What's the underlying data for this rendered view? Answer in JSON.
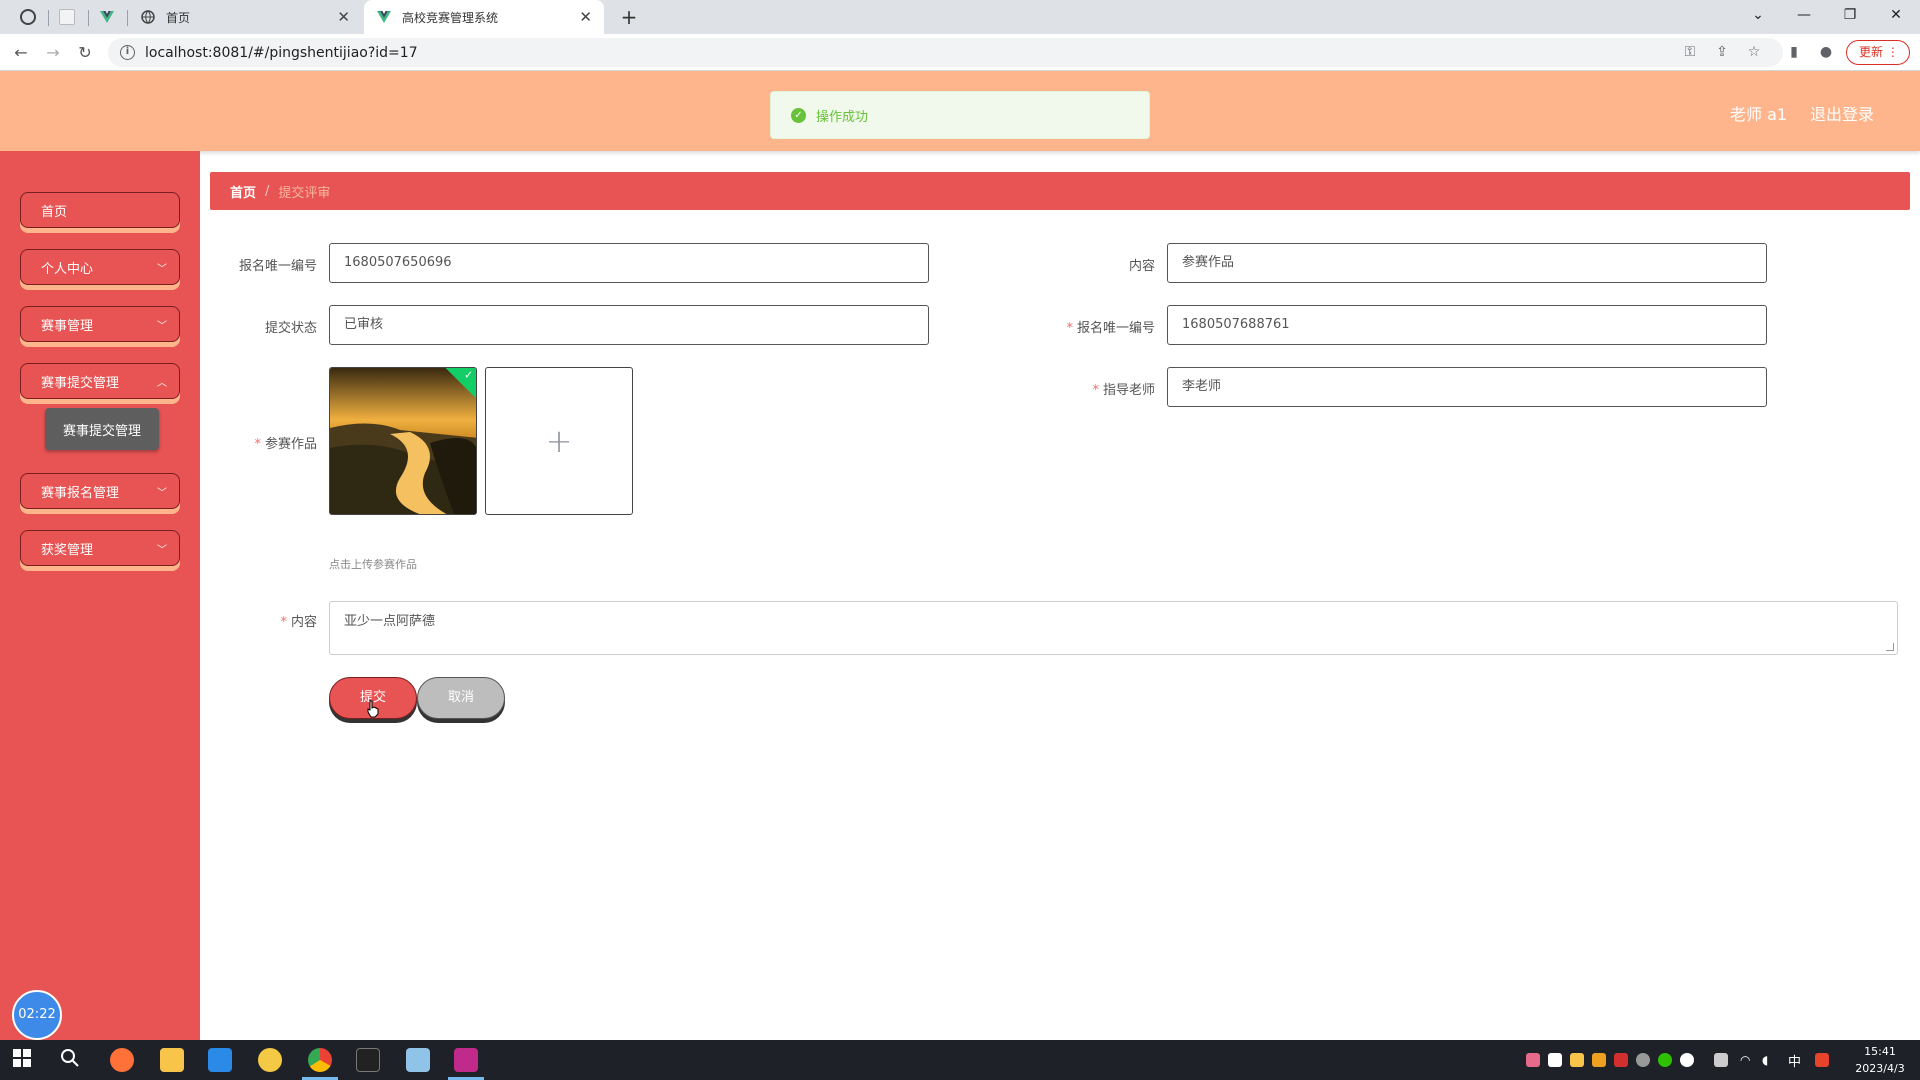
{
  "browser": {
    "tabs": [
      {
        "title": "首页"
      },
      {
        "title": "高校竞赛管理系统"
      }
    ],
    "url": "localhost:8081/#/pingshentijiao?id=17",
    "update_label": "更新"
  },
  "header": {
    "user": "老师 a1",
    "logout": "退出登录"
  },
  "toast": {
    "message": "操作成功"
  },
  "sidebar": {
    "items": [
      {
        "label": "首页"
      },
      {
        "label": "个人中心"
      },
      {
        "label": "赛事管理"
      },
      {
        "label": "赛事提交管理"
      },
      {
        "label": "赛事报名管理"
      },
      {
        "label": "获奖管理"
      }
    ],
    "submenu": {
      "label": "赛事提交管理"
    },
    "timer": "02:22"
  },
  "breadcrumb": {
    "home": "首页",
    "separator": "/",
    "current": "提交评审"
  },
  "form": {
    "baoming_id_1": {
      "label": "报名唯一编号",
      "value": "1680507650696"
    },
    "neirong_top": {
      "label": "内容",
      "value": "参赛作品"
    },
    "tijiao_zhuangtai": {
      "label": "提交状态",
      "value": "已审核"
    },
    "baoming_id_2": {
      "label": "报名唯一编号",
      "value": "1680507688761"
    },
    "zhidao_laoshi": {
      "label": "指导老师",
      "value": "李老师"
    },
    "cansai_zuopin": {
      "label": "参赛作品",
      "tip": "点击上传参赛作品"
    },
    "neirong": {
      "label": "内容",
      "value": "亚少一点阿萨德"
    },
    "submit_label": "提交",
    "cancel_label": "取消"
  },
  "taskbar": {
    "lang": "中",
    "time": "15:41",
    "date": "2023/4/3"
  },
  "colors": {
    "header": "#ffb58c",
    "sidebar": "#e85353",
    "toast_success": "#67c23a",
    "required": "#f56c6c"
  }
}
